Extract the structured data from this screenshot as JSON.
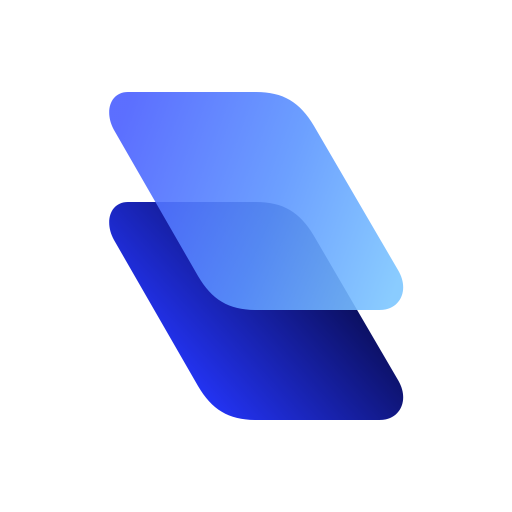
{
  "logo": {
    "icon_name": "stacked-layers-icon",
    "background_color": "#ffffff",
    "colors": {
      "bottom_layer_dark": "#0b0f5e",
      "bottom_layer_bright": "#2536ff",
      "top_layer_left": "#4a64ff",
      "top_layer_right": "#7cc4ff"
    }
  }
}
